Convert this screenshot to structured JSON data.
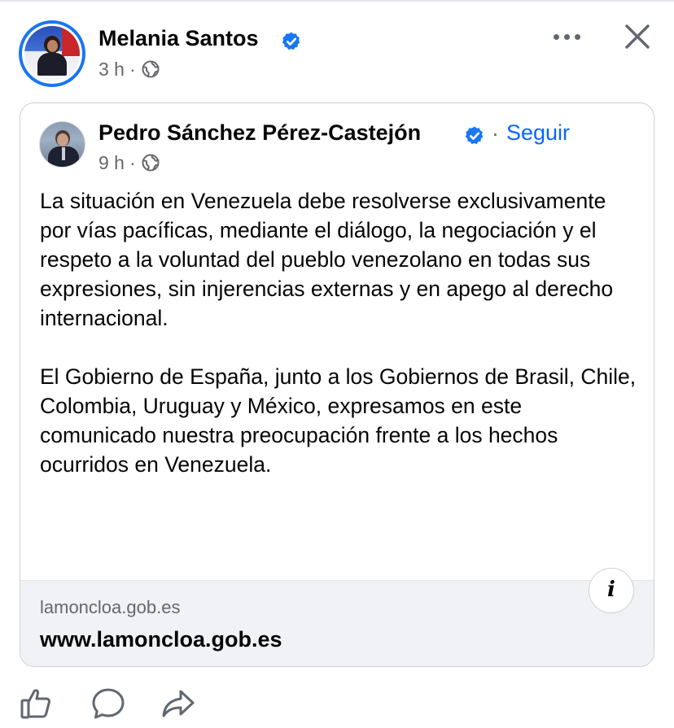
{
  "post": {
    "author": {
      "name": "Melania Santos",
      "verified": true
    },
    "time": "3 h",
    "separator": "·",
    "audience_icon": "globe-icon",
    "more_icon": "more-options-icon",
    "close_icon": "close-icon"
  },
  "shared": {
    "author": {
      "name": "Pedro Sánchez Pérez-Castejón",
      "verified": true
    },
    "separator": "·",
    "follow_label": "Seguir",
    "time": "9 h",
    "audience_icon": "globe-icon",
    "paragraphs": [
      "La situación en Venezuela debe resolverse exclusivamente por vías pacíficas, mediante el diálogo, la negociación y el respeto a la voluntad del pueblo venezolano en todas sus expresiones, sin injerencias externas y en apego al derecho internacional.",
      "El Gobierno de España, junto a los Gobiernos de Brasil, Chile, Colombia, Uruguay y México, expresamos en este comunicado nuestra preocupación frente a los hechos ocurridos en Venezuela."
    ],
    "link": {
      "domain": "lamoncloa.gob.es",
      "title": "www.lamoncloa.gob.es",
      "info_label": "i"
    }
  },
  "actions": [
    {
      "icon": "like-icon"
    },
    {
      "icon": "comment-icon"
    },
    {
      "icon": "share-icon"
    }
  ],
  "colors": {
    "accent": "#0866ff",
    "verified_badge": "#1877f2",
    "meta_text": "#65676b",
    "card_border": "#ced0d4",
    "preview_bg": "#f0f2f5"
  }
}
